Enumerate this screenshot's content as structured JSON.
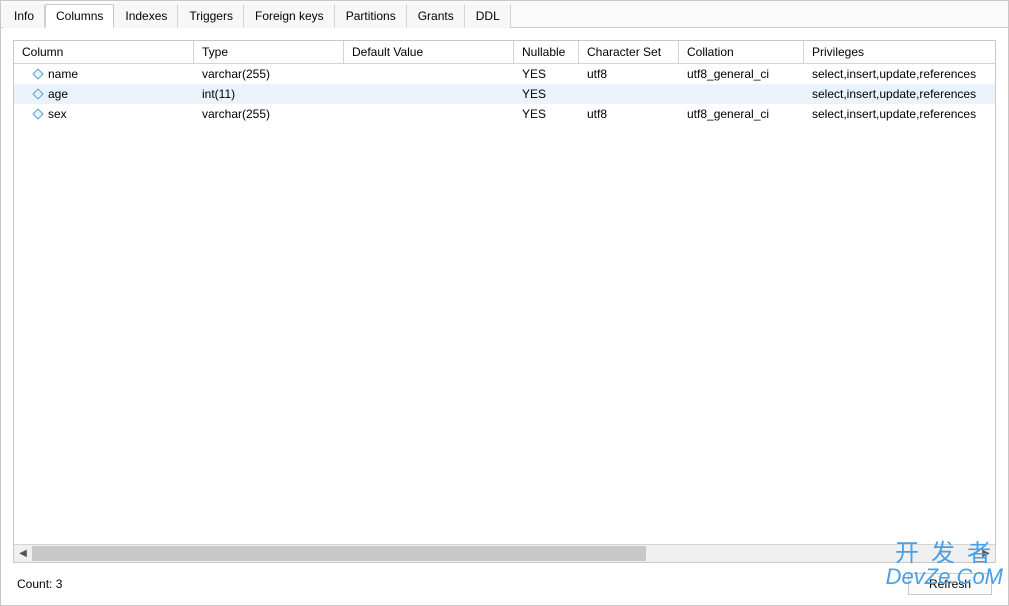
{
  "tabs": [
    {
      "label": "Info"
    },
    {
      "label": "Columns"
    },
    {
      "label": "Indexes"
    },
    {
      "label": "Triggers"
    },
    {
      "label": "Foreign keys"
    },
    {
      "label": "Partitions"
    },
    {
      "label": "Grants"
    },
    {
      "label": "DDL"
    }
  ],
  "active_tab_index": 1,
  "columns_panel": {
    "headers": [
      "Column",
      "Type",
      "Default Value",
      "Nullable",
      "Character Set",
      "Collation",
      "Privileges"
    ],
    "rows": [
      {
        "name": "name",
        "type": "varchar(255)",
        "default": "",
        "nullable": "YES",
        "charset": "utf8",
        "collation": "utf8_general_ci",
        "privs": "select,insert,update,references"
      },
      {
        "name": "age",
        "type": "int(11)",
        "default": "",
        "nullable": "YES",
        "charset": "",
        "collation": "",
        "privs": "select,insert,update,references"
      },
      {
        "name": "sex",
        "type": "varchar(255)",
        "default": "",
        "nullable": "YES",
        "charset": "utf8",
        "collation": "utf8_general_ci",
        "privs": "select,insert,update,references"
      }
    ],
    "selected_row_index": 1
  },
  "footer": {
    "count_label": "Count: 3",
    "refresh_label": "Refresh"
  },
  "watermark": {
    "line1": "开发者",
    "line2": "DevZe.CoM"
  }
}
